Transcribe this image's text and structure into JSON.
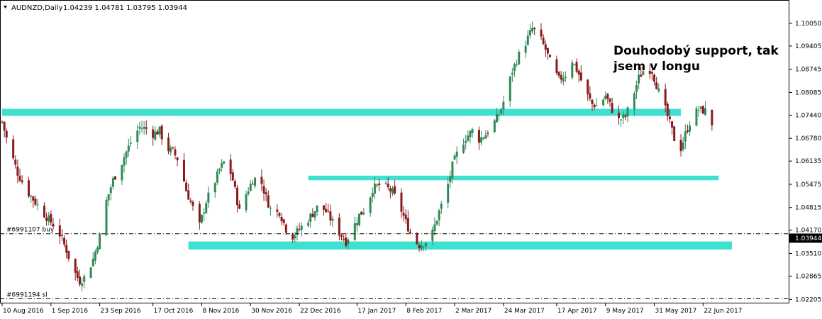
{
  "header": {
    "symbol_timeframe": "AUDNZD,Daily",
    "ohlc": "1.04239 1.04781 1.03795 1.03944"
  },
  "annotation": {
    "line1": "Douhodobý support, tak",
    "line2": "jsem v longu"
  },
  "order_labels": {
    "buy": "#6991107 buy",
    "sl": "#6991194 sl"
  },
  "price_axis": {
    "ticks": [
      "1.10050",
      "1.09405",
      "1.08745",
      "1.08085",
      "1.07440",
      "1.06780",
      "1.06135",
      "1.05475",
      "1.04815",
      "1.04170",
      "1.03510",
      "1.02865",
      "1.02205"
    ],
    "current_price": "1.03944"
  },
  "time_axis": {
    "ticks": [
      "10 Aug 2016",
      "1 Sep 2016",
      "23 Sep 2016",
      "17 Oct 2016",
      "8 Nov 2016",
      "30 Nov 2016",
      "22 Dec 2016",
      "17 Jan 2017",
      "8 Feb 2017",
      "2 Mar 2017",
      "24 Mar 2017",
      "17 Apr 2017",
      "9 May 2017",
      "31 May 2017",
      "22 Jun 2017"
    ]
  },
  "zones": [
    {
      "name": "upper-resistance-zone",
      "top": 1.0762,
      "bottom": 1.0742,
      "start_date": "2016-08-10",
      "end_date": "2017-06-12"
    },
    {
      "name": "middle-resistance-zone",
      "top": 1.0572,
      "bottom": 1.0559,
      "start_date": "2016-12-26",
      "end_date": "2017-06-29"
    },
    {
      "name": "support-zone",
      "top": 1.0385,
      "bottom": 1.0362,
      "start_date": "2016-11-02",
      "end_date": "2017-07-05"
    }
  ],
  "order_lines": {
    "buy_price": 1.0407,
    "sl_price": 1.0222
  },
  "colors": {
    "background": "#ffffff",
    "zone": "#40E0D0",
    "bull_candle": "#2e8b57",
    "bear_candle": "#8b1a1a",
    "text": "#000000",
    "order_line": "#000000"
  },
  "chart_data": {
    "type": "candlestick",
    "title": "AUDNZD,Daily",
    "ylim": [
      1.0215,
      1.1035
    ],
    "start_date": "2016-08-10",
    "end_date": "2017-06-26",
    "close_series": [
      [
        0,
        1.0725
      ],
      [
        3,
        1.0655
      ],
      [
        7,
        1.058
      ],
      [
        11,
        1.053
      ],
      [
        14,
        1.0505
      ],
      [
        18,
        1.047
      ],
      [
        22,
        1.044
      ],
      [
        25,
        1.042
      ],
      [
        29,
        1.036
      ],
      [
        32,
        1.0305
      ],
      [
        35,
        1.0272
      ],
      [
        38,
        1.0288
      ],
      [
        41,
        1.0335
      ],
      [
        44,
        1.04
      ],
      [
        47,
        1.05
      ],
      [
        50,
        1.056
      ],
      [
        53,
        1.0595
      ],
      [
        56,
        1.064
      ],
      [
        59,
        1.068
      ],
      [
        62,
        1.071
      ],
      [
        65,
        1.0705
      ],
      [
        68,
        1.069
      ],
      [
        71,
        1.07
      ],
      [
        74,
        1.065
      ],
      [
        77,
        1.064
      ],
      [
        80,
        1.061
      ],
      [
        83,
        1.053
      ],
      [
        86,
        1.048
      ],
      [
        89,
        1.043
      ],
      [
        92,
        1.05
      ],
      [
        95,
        1.054
      ],
      [
        98,
        1.059
      ],
      [
        101,
        1.062
      ],
      [
        104,
        1.056
      ],
      [
        107,
        1.047
      ],
      [
        110,
        1.052
      ],
      [
        113,
        1.056
      ],
      [
        116,
        1.057
      ],
      [
        119,
        1.051
      ],
      [
        122,
        1.046
      ],
      [
        125,
        1.047
      ],
      [
        128,
        1.042
      ],
      [
        131,
        1.04
      ],
      [
        134,
        1.042
      ],
      [
        137,
        1.044
      ],
      [
        140,
        1.0465
      ],
      [
        143,
        1.049
      ],
      [
        146,
        1.047
      ],
      [
        149,
        1.044
      ],
      [
        152,
        1.041
      ],
      [
        155,
        1.0385
      ],
      [
        158,
        1.042
      ],
      [
        161,
        1.046
      ],
      [
        164,
        1.048
      ],
      [
        167,
        1.0535
      ],
      [
        170,
        1.0545
      ],
      [
        173,
        1.054
      ],
      [
        176,
        1.0525
      ],
      [
        179,
        1.049
      ],
      [
        182,
        1.044
      ],
      [
        185,
        1.0395
      ],
      [
        188,
        1.0375
      ],
      [
        191,
        1.0385
      ],
      [
        194,
        1.041
      ],
      [
        197,
        1.047
      ],
      [
        200,
        1.052
      ],
      [
        203,
        1.06
      ],
      [
        206,
        1.065
      ],
      [
        209,
        1.068
      ],
      [
        212,
        1.07
      ],
      [
        215,
        1.0675
      ],
      [
        218,
        1.069
      ],
      [
        221,
        1.0715
      ],
      [
        224,
        1.0745
      ],
      [
        227,
        1.08
      ],
      [
        230,
        1.087
      ],
      [
        233,
        1.0915
      ],
      [
        236,
        1.095
      ],
      [
        239,
        1.099
      ],
      [
        242,
        1.097
      ],
      [
        245,
        1.093
      ],
      [
        248,
        1.088
      ],
      [
        251,
        1.0845
      ],
      [
        254,
        1.086
      ],
      [
        257,
        1.09
      ],
      [
        260,
        1.086
      ],
      [
        263,
        1.081
      ],
      [
        266,
        1.0775
      ],
      [
        269,
        1.077
      ],
      [
        272,
        1.08
      ],
      [
        275,
        1.076
      ],
      [
        278,
        1.073
      ],
      [
        281,
        1.074
      ],
      [
        284,
        1.079
      ],
      [
        287,
        1.085
      ],
      [
        290,
        1.088
      ],
      [
        293,
        1.087
      ],
      [
        296,
        1.081
      ],
      [
        299,
        1.076
      ],
      [
        302,
        1.07
      ],
      [
        305,
        1.063
      ],
      [
        308,
        1.069
      ],
      [
        311,
        1.074
      ],
      [
        314,
        1.076
      ],
      [
        317,
        1.0755
      ],
      [
        320,
        1.072
      ],
      [
        323,
        1.067
      ],
      [
        326,
        1.062
      ],
      [
        329,
        1.055
      ],
      [
        332,
        1.049
      ],
      [
        335,
        1.044
      ],
      [
        338,
        1.042
      ],
      [
        341,
        1.045
      ],
      [
        344,
        1.047
      ],
      [
        347,
        1.0455
      ],
      [
        350,
        1.044
      ],
      [
        353,
        1.048
      ],
      [
        356,
        1.05
      ],
      [
        359,
        1.047
      ],
      [
        362,
        1.042
      ],
      [
        365,
        1.0394
      ]
    ]
  }
}
